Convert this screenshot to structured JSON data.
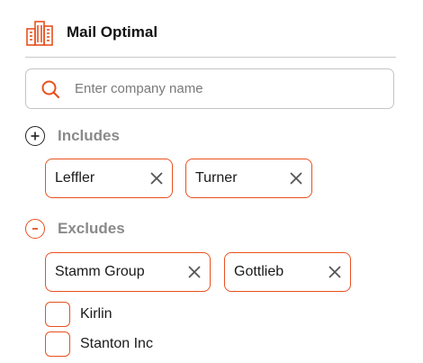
{
  "app": {
    "title": "Mail Optimal",
    "logo_icon": "buildings-icon"
  },
  "search": {
    "placeholder": "Enter company name",
    "value": ""
  },
  "includes": {
    "label": "Includes",
    "chips": [
      {
        "label": "Leffler"
      },
      {
        "label": "Turner"
      }
    ]
  },
  "excludes": {
    "label": "Excludes",
    "chips": [
      {
        "label": "Stamm Group"
      },
      {
        "label": "Gottlieb"
      }
    ],
    "options": [
      {
        "label": "Kirlin",
        "checked": false
      },
      {
        "label": "Stanton Inc",
        "checked": false
      }
    ]
  },
  "colors": {
    "accent": "#e8511f",
    "muted": "#8a8a8a",
    "border": "#c4c4c4"
  }
}
